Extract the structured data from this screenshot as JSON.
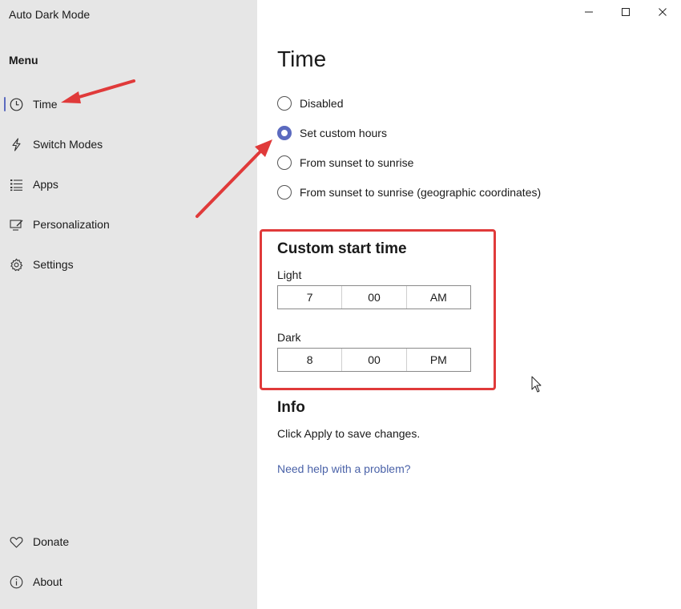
{
  "app": {
    "title": "Auto Dark Mode"
  },
  "sidebar": {
    "menu_header": "Menu",
    "items": [
      {
        "label": "Time",
        "icon": "clock-icon",
        "selected": true
      },
      {
        "label": "Switch Modes",
        "icon": "lightning-icon"
      },
      {
        "label": "Apps",
        "icon": "list-icon"
      },
      {
        "label": "Personalization",
        "icon": "personalization-icon"
      },
      {
        "label": "Settings",
        "icon": "gear-icon"
      }
    ],
    "footer_items": [
      {
        "label": "Donate",
        "icon": "heart-icon"
      },
      {
        "label": "About",
        "icon": "info-icon"
      }
    ]
  },
  "window_controls": [
    "minimize-icon",
    "maximize-icon",
    "close-icon"
  ],
  "main": {
    "title": "Time",
    "options": [
      {
        "label": "Disabled",
        "checked": false
      },
      {
        "label": "Set custom hours",
        "checked": true
      },
      {
        "label": "From sunset to sunrise",
        "checked": false
      },
      {
        "label": "From sunset to sunrise (geographic coordinates)",
        "checked": false
      }
    ],
    "custom_start": {
      "title": "Custom start time",
      "light": {
        "label": "Light",
        "hour": "7",
        "minute": "00",
        "period": "AM"
      },
      "dark": {
        "label": "Dark",
        "hour": "8",
        "minute": "00",
        "period": "PM"
      }
    },
    "info": {
      "title": "Info",
      "text": "Click Apply to save changes.",
      "help_link": "Need help with a problem?"
    }
  },
  "colors": {
    "sidebar_bg": "#e6e6e6",
    "accent": "#5b6abf",
    "annotation": "#e03a3a",
    "link": "#4a62a8"
  }
}
